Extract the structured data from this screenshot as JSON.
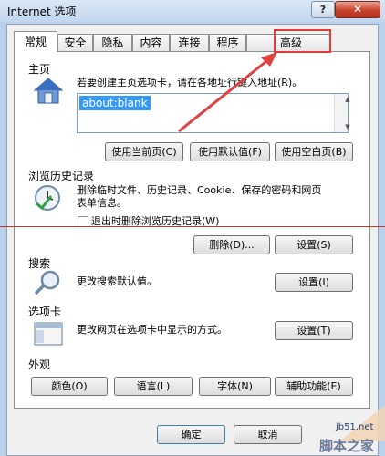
{
  "window": {
    "title": "Internet 选项",
    "help_label": "?",
    "close_label": "✕"
  },
  "tabs": [
    {
      "label": "常规",
      "active": true
    },
    {
      "label": "安全"
    },
    {
      "label": "隐私"
    },
    {
      "label": "内容"
    },
    {
      "label": "连接"
    },
    {
      "label": "程序"
    },
    {
      "label": "高级"
    }
  ],
  "home": {
    "section": "主页",
    "description": "若要创建主页选项卡，请在各地址行键入地址(R)。",
    "url_value": "about:blank",
    "btn_current": "使用当前页(C)",
    "btn_default": "使用默认值(F)",
    "btn_blank": "使用空白页(B)"
  },
  "history": {
    "section": "浏览历史记录",
    "description_line1": "删除临时文件、历史记录、Cookie、保存的密码和网页",
    "description_line2": "表单信息。",
    "checkbox_label": "退出时删除浏览历史记录(W)",
    "checkbox_checked": false,
    "btn_delete": "删除(D)...",
    "btn_settings": "设置(S)"
  },
  "search": {
    "section": "搜索",
    "description": "更改搜索默认值。",
    "btn_settings": "设置(I)"
  },
  "tabs_section": {
    "section": "选项卡",
    "description": "更改网页在选项卡中显示的方式。",
    "btn_settings": "设置(T)"
  },
  "appearance": {
    "section": "外观",
    "btn_colors": "颜色(O)",
    "btn_languages": "语言(L)",
    "btn_fonts": "字体(N)",
    "btn_accessibility": "辅助功能(E)"
  },
  "footer": {
    "btn_ok": "确定",
    "btn_cancel": "取消"
  },
  "watermark": {
    "site": "jb51.net",
    "brand": "脚本之家"
  },
  "colors": {
    "highlight": "#e03c3c",
    "selection": "#3399ff"
  }
}
